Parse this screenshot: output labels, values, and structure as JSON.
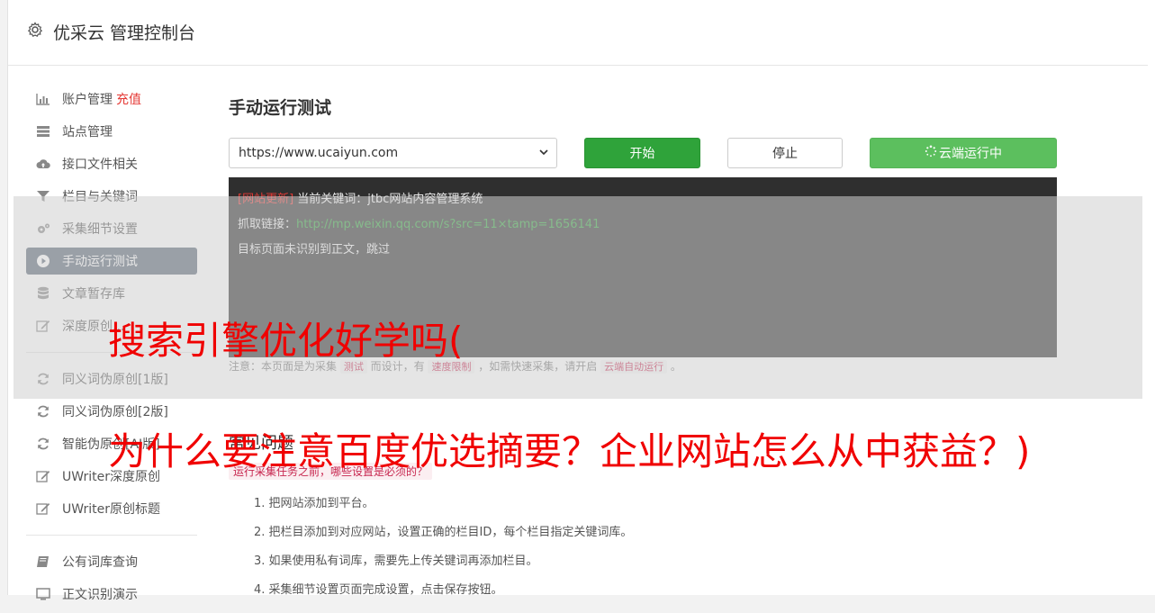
{
  "header": {
    "title": "优采云 管理控制台",
    "icon": "gear-icon"
  },
  "sidebar": {
    "items": [
      {
        "label": "账户管理",
        "extra": "充值",
        "icon": "bar-chart-icon"
      },
      {
        "label": "站点管理",
        "icon": "server-icon"
      },
      {
        "label": "接口文件相关",
        "icon": "cloud-upload-icon"
      },
      {
        "label": "栏目与关键词",
        "icon": "filter-icon"
      },
      {
        "label": "采集细节设置",
        "icon": "gears-icon"
      },
      {
        "label": "手动运行测试",
        "icon": "play-circle-icon",
        "active": true
      },
      {
        "label": "文章暂存库",
        "icon": "database-icon"
      },
      {
        "label": "深度原创...",
        "icon": "edit-icon"
      },
      {
        "label": "同义词伪原创[1版]",
        "icon": "refresh-icon"
      },
      {
        "label": "同义词伪原创[2版]",
        "icon": "refresh-icon"
      },
      {
        "label": "智能伪原创[AI版]",
        "icon": "refresh-icon"
      },
      {
        "label": "UWriter深度原创",
        "icon": "edit-icon"
      },
      {
        "label": "UWriter原创标题",
        "icon": "edit-icon"
      },
      {
        "label": "公有词库查询",
        "icon": "book-icon"
      },
      {
        "label": "正文识别演示",
        "icon": "monitor-icon"
      }
    ]
  },
  "main": {
    "title": "手动运行测试",
    "url_select": "https://www.ucaiyun.com",
    "buttons": {
      "start": "开始",
      "stop": "停止",
      "cloud": "云端运行中"
    },
    "console": {
      "line1_tag": "[网站更新]",
      "line1_text": " 当前关键词：jtbc网站内容管理系统",
      "line2_label": "抓取链接：",
      "line2_link": "http://mp.weixin.qq.com/s?src=11×tamp=1656141",
      "line3": "目标页面未识别到正文，跳过"
    },
    "notice": {
      "p1": "注意：本页面是为采集 ",
      "c1": "测试",
      "p2": " 而设计，有 ",
      "c2": "速度限制",
      "p3": " ，如需快速采集，请开启 ",
      "c3": "云端自动运行",
      "p4": " 。"
    },
    "faq": {
      "title": "常见问题",
      "question": "运行采集任务之前，哪些设置是必须的？",
      "items": [
        "1. 把网站添加到平台。",
        "2. 把栏目添加到对应网站，设置正确的栏目ID，每个栏目指定关键词库。",
        "3. 如果使用私有词库，需要先上传关键词再添加栏目。",
        "4. 采集细节设置页面完成设置，点击保存按钮。"
      ]
    }
  },
  "overlay": {
    "line1": "搜索引擎优化好学吗(",
    "line2": "为什么要注意百度优选摘要？企业网站怎么从中获益？)"
  }
}
